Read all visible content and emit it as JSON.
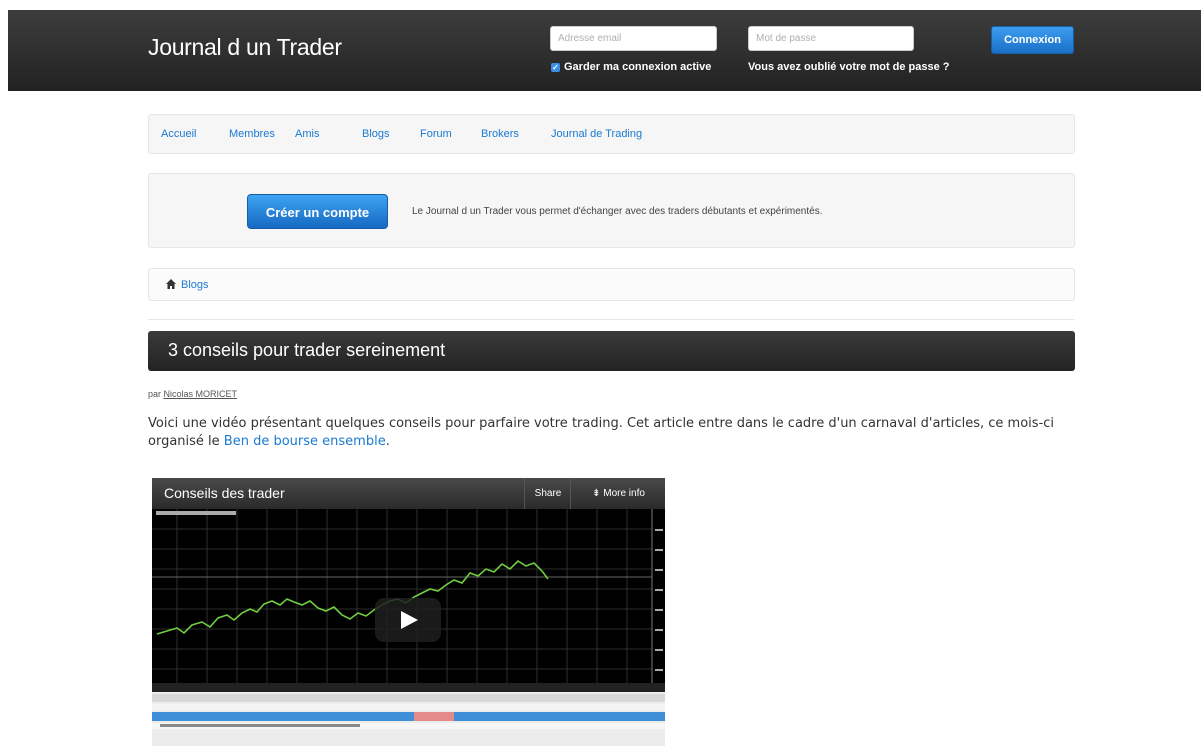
{
  "header": {
    "brand": "Journal d un Trader",
    "email_placeholder": "Adresse email",
    "password_placeholder": "Mot de passe",
    "remember_label": "Garder ma connexion active",
    "forgot_label": "Vous avez oublié votre mot de passe ?",
    "login_label": "Connexion"
  },
  "nav": {
    "items": [
      "Accueil",
      "Membres",
      "Amis",
      "Blogs",
      "Forum",
      "Brokers",
      "Journal de Trading"
    ]
  },
  "hero": {
    "create_label": "Créer un compte",
    "text": "Le Journal d un Trader vous permet d'échanger avec des traders débutants et expérimentés."
  },
  "breadcrumb": {
    "home_icon": "home-icon",
    "current": "Blogs"
  },
  "article": {
    "title": "3 conseils pour trader sereinement",
    "by_prefix": "par",
    "author": "Nicolas MORICET",
    "intro_text": "Voici une vidéo présentant quelques conseils pour parfaire votre trading. Cet article entre dans le cadre d'un carnaval d'articles, ce mois-ci organisé le ",
    "intro_link": "Ben de bourse ensemble",
    "intro_end": "."
  },
  "video": {
    "title": "Conseils des trader",
    "share_label": "Share",
    "more_label": "More info",
    "play_icon": "play-icon",
    "accent_line": "#6fcf3f",
    "grid_color": "#3a3a3a"
  },
  "colors": {
    "link": "#1a7ad2",
    "button_blue": "#1f7ad6",
    "dark_bar": "#2b2b2b"
  }
}
